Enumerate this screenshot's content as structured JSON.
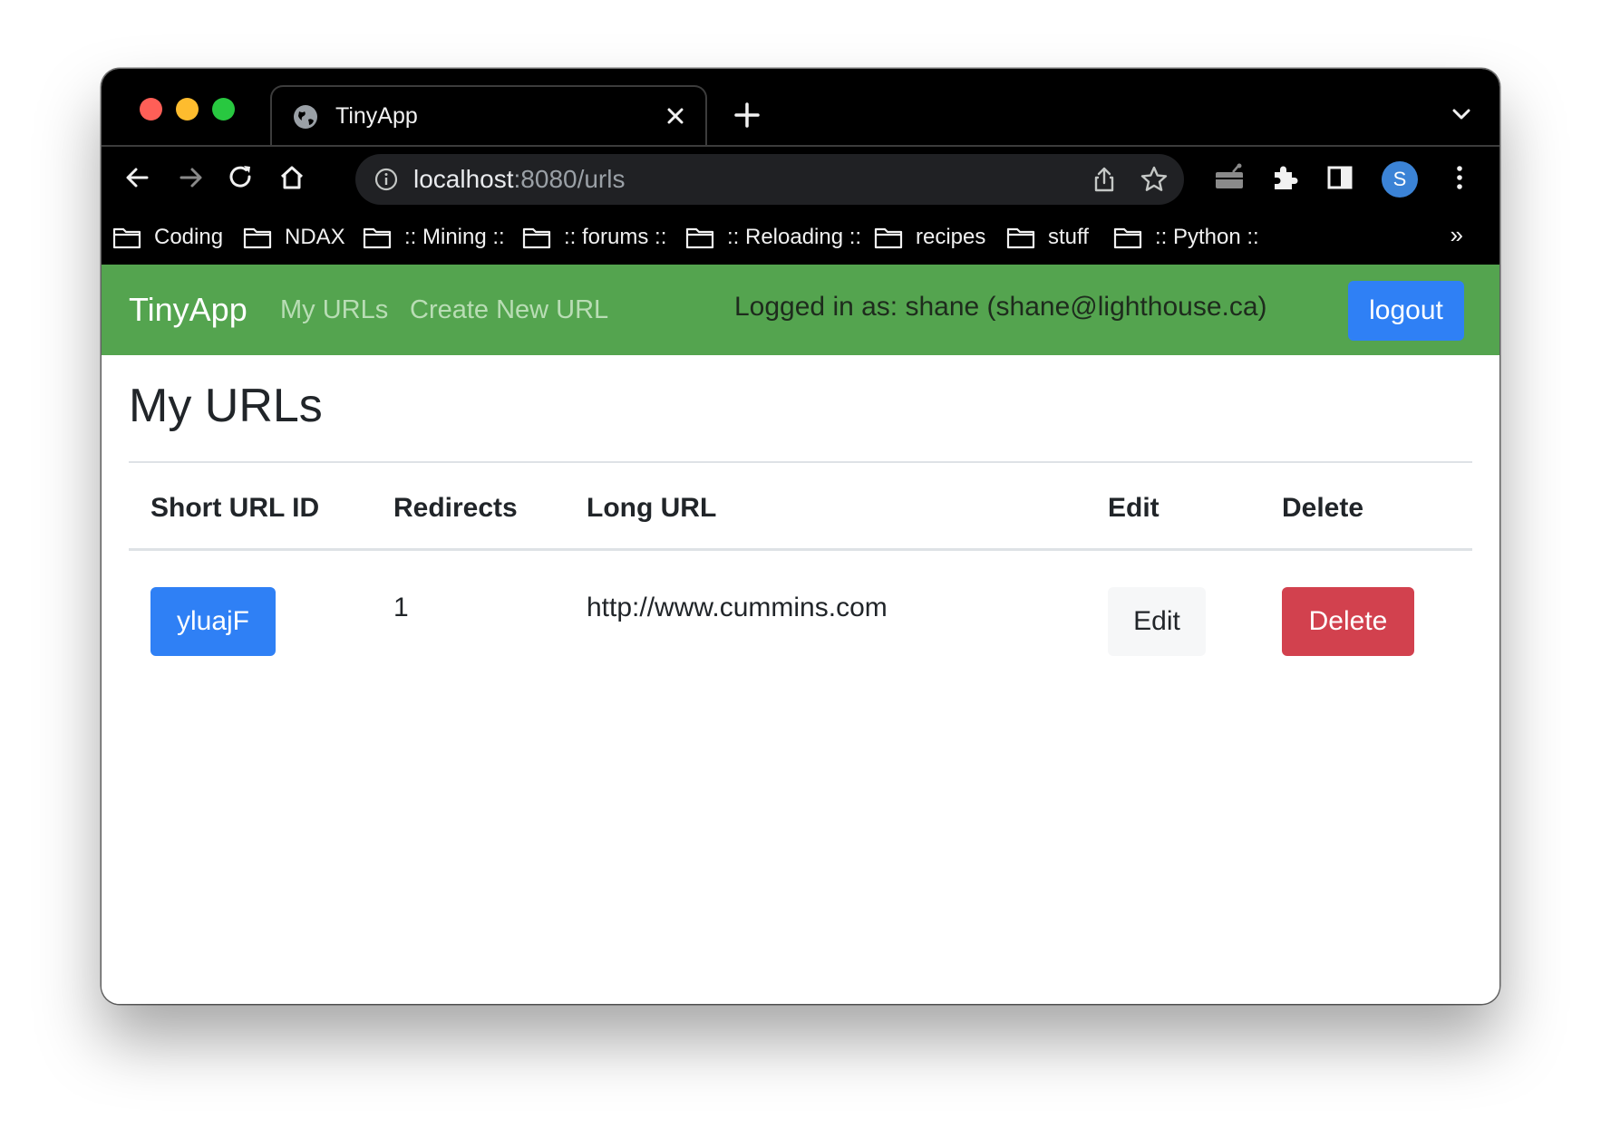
{
  "browser": {
    "tab_title": "TinyApp",
    "url_host": "localhost",
    "url_rest": ":8080/urls",
    "profile_initial": "S",
    "bookmarks": [
      "Coding",
      "NDAX",
      ":: Mining ::",
      ":: forums ::",
      ":: Reloading ::",
      "recipes",
      "stuff",
      ":: Python ::"
    ],
    "bookmarks_more": "»"
  },
  "navbar": {
    "brand": "TinyApp",
    "links": [
      "My URLs",
      "Create New URL"
    ],
    "logged_in_text": "Logged in as: shane (shane@lighthouse.ca)",
    "logout_label": "logout"
  },
  "main": {
    "heading": "My URLs",
    "table": {
      "headers": [
        "Short URL ID",
        "Redirects",
        "Long URL",
        "Edit",
        "Delete"
      ],
      "rows": [
        {
          "short_id": "yluajF",
          "redirects": "1",
          "long_url": "http://www.cummins.com",
          "edit_label": "Edit",
          "delete_label": "Delete"
        }
      ]
    }
  },
  "colors": {
    "navbar_green": "#54a44f",
    "primary_blue": "#2f80f5",
    "danger_red": "#d2414e"
  },
  "icons": [
    "globe-icon",
    "close-icon",
    "plus-icon",
    "chevron-down-icon",
    "back-arrow-icon",
    "forward-arrow-icon",
    "reload-icon",
    "home-icon",
    "info-icon",
    "share-icon",
    "star-icon",
    "media-icon",
    "extensions-icon",
    "side-panel-icon",
    "kebab-menu-icon",
    "folder-icon"
  ]
}
